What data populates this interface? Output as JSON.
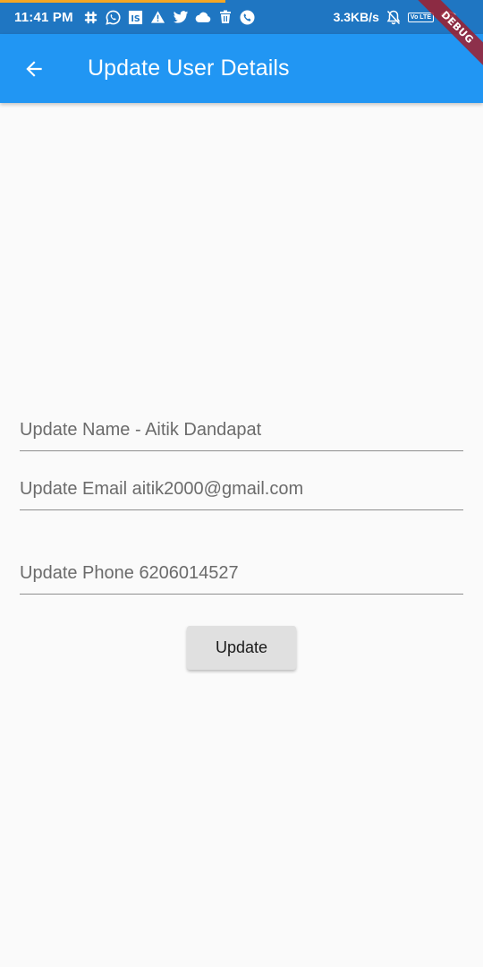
{
  "status_bar": {
    "time": "11:41 PM",
    "left_icons": [
      "slack-icon",
      "whatsapp-icon",
      "is-app-icon",
      "warning-icon",
      "twitter-icon",
      "cloud-icon",
      "trash-icon",
      "phone-icon"
    ],
    "is_icon_text": "IS",
    "net_speed": "3.3KB/s",
    "volte_text": "Vo LTE",
    "right_icons": [
      "bell-off-icon",
      "volte-icon",
      "wifi-icon"
    ],
    "progress_color": "#f5a623"
  },
  "debug_banner": "DEBUG",
  "app_bar": {
    "title": "Update User Details",
    "back_icon": "arrow-back-icon",
    "color": "#2196f3"
  },
  "form": {
    "name_placeholder": "Update Name - Aitik Dandapat",
    "email_placeholder": "Update Email aitik2000@gmail.com",
    "phone_placeholder": "Update Phone 6206014527",
    "update_label": "Update"
  }
}
